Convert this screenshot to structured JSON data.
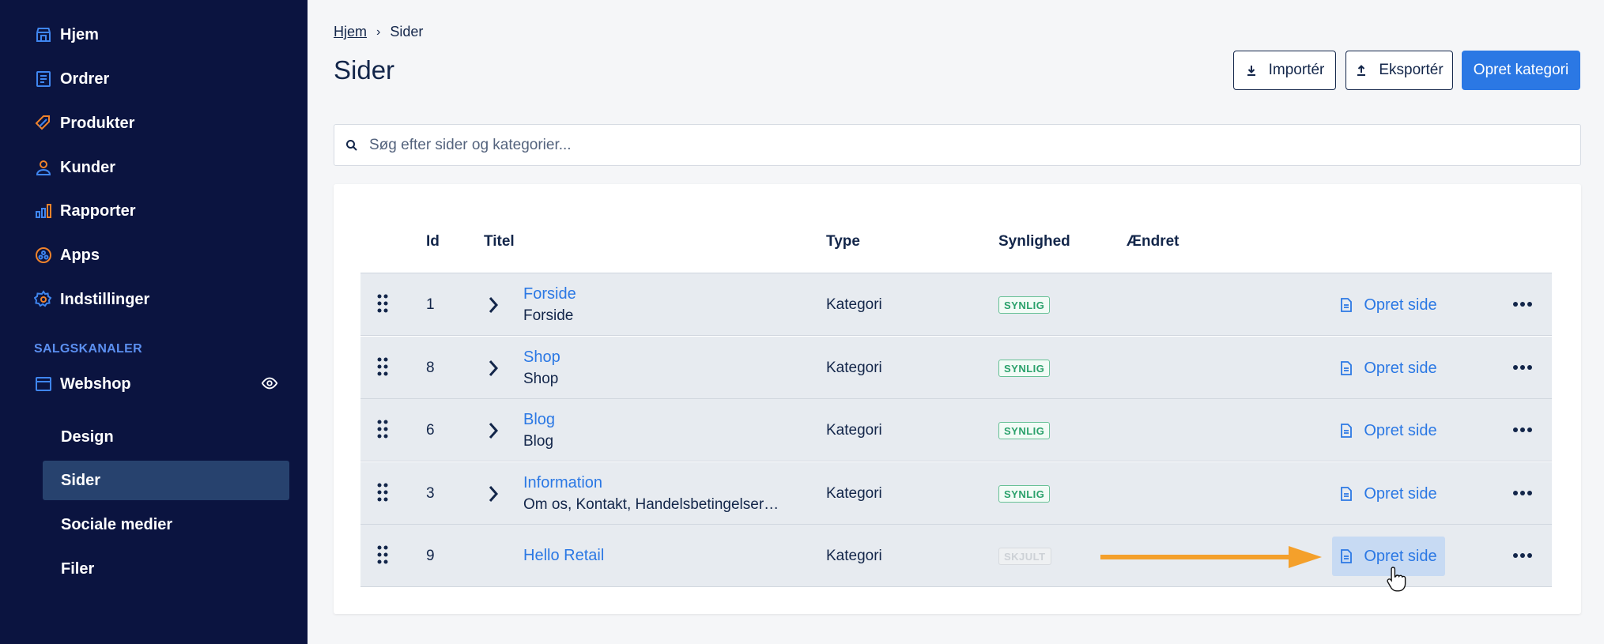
{
  "sidebar": {
    "items": [
      {
        "label": "Hjem",
        "icon": "store-icon"
      },
      {
        "label": "Ordrer",
        "icon": "orders-icon"
      },
      {
        "label": "Produkter",
        "icon": "tag-icon"
      },
      {
        "label": "Kunder",
        "icon": "user-icon"
      },
      {
        "label": "Rapporter",
        "icon": "bar-chart-icon"
      },
      {
        "label": "Apps",
        "icon": "apps-icon"
      },
      {
        "label": "Indstillinger",
        "icon": "gear-icon"
      }
    ],
    "section_label": "SALGSKANALER",
    "channel": {
      "label": "Webshop",
      "icon": "storefront-icon"
    },
    "sub_items": [
      {
        "label": "Design"
      },
      {
        "label": "Sider"
      },
      {
        "label": "Sociale medier"
      },
      {
        "label": "Filer"
      }
    ],
    "accent_color": "#f0832b"
  },
  "breadcrumb": {
    "home": "Hjem",
    "current": "Sider"
  },
  "page_title": "Sider",
  "actions": {
    "import": "Importér",
    "export": "Eksportér",
    "create_category": "Opret kategori"
  },
  "search": {
    "placeholder": "Søg efter sider og kategorier..."
  },
  "table": {
    "headers": {
      "id": "Id",
      "title": "Titel",
      "type": "Type",
      "visibility": "Synlighed",
      "changed": "Ændret"
    },
    "rows": [
      {
        "id": "1",
        "title": "Forside",
        "subtitle": "Forside",
        "type": "Kategori",
        "visibility": "SYNLIG",
        "action": "Opret side"
      },
      {
        "id": "8",
        "title": "Shop",
        "subtitle": "Shop",
        "type": "Kategori",
        "visibility": "SYNLIG",
        "action": "Opret side"
      },
      {
        "id": "6",
        "title": "Blog",
        "subtitle": "Blog",
        "type": "Kategori",
        "visibility": "SYNLIG",
        "action": "Opret side"
      },
      {
        "id": "3",
        "title": "Information",
        "subtitle": "Om os, Kontakt, Handelsbetingelser…",
        "type": "Kategori",
        "visibility": "SYNLIG",
        "action": "Opret side"
      },
      {
        "id": "9",
        "title": "Hello Retail",
        "subtitle": "",
        "type": "Kategori",
        "visibility": "SKJULT",
        "action": "Opret side"
      }
    ]
  },
  "colors": {
    "primary": "#2b78e4",
    "sidebar_bg": "#0b1440",
    "visible_badge": "#2aa16b",
    "annotation_arrow": "#f4a02b"
  }
}
